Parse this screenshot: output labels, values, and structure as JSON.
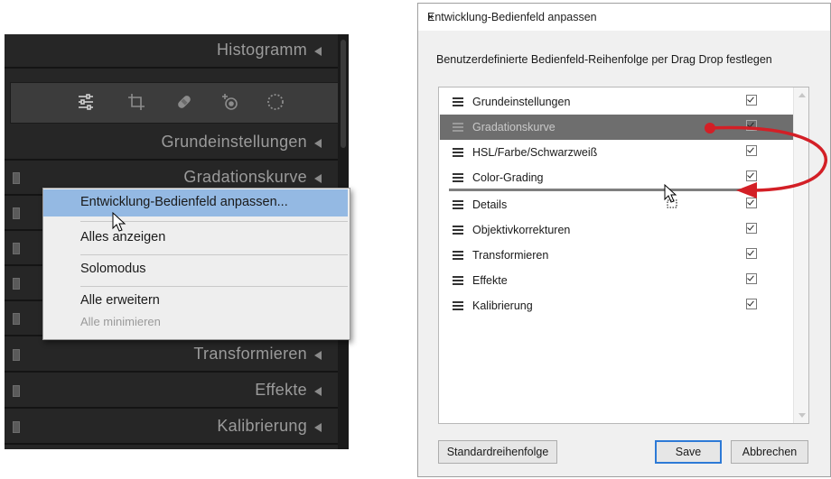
{
  "left_panel": {
    "rows": [
      {
        "label": "Histogramm"
      },
      {
        "label": "Grundeinstellungen"
      },
      {
        "label": "Gradationskurve"
      },
      {
        "label": "Transformieren"
      },
      {
        "label": "Effekte"
      },
      {
        "label": "Kalibrierung"
      }
    ],
    "tools": [
      "sliders-icon",
      "crop-icon",
      "healing-icon",
      "redeye-icon",
      "mask-icon"
    ]
  },
  "context_menu": {
    "items": [
      {
        "label": "Entwicklung-Bedienfeld anpassen..."
      },
      {
        "label": "Alles anzeigen"
      },
      {
        "label": "Solomodus"
      },
      {
        "label": "Alle erweitern"
      },
      {
        "label": "Alle minimieren"
      }
    ]
  },
  "dialog": {
    "title": "Entwicklung-Bedienfeld anpassen",
    "close": "×",
    "instruction": "Benutzerdefinierte Bedienfeld-Reihenfolge per Drag  Drop festlegen",
    "items": [
      {
        "label": "Grundeinstellungen",
        "checked": true
      },
      {
        "label": "Gradationskurve",
        "checked": true,
        "selected": true
      },
      {
        "label": "HSL/Farbe/Schwarzweiß",
        "checked": true
      },
      {
        "label": "Color-Grading",
        "checked": true
      },
      {
        "label": "Details",
        "checked": true
      },
      {
        "label": "Objektivkorrekturen",
        "checked": true
      },
      {
        "label": "Transformieren",
        "checked": true
      },
      {
        "label": "Effekte",
        "checked": true
      },
      {
        "label": "Kalibrierung",
        "checked": true
      }
    ],
    "buttons": {
      "default_order": "Standardreihenfolge",
      "save": "Save",
      "cancel": "Abbrechen"
    }
  },
  "colors": {
    "panel_bg": "#262626",
    "menu_highlight": "#94b9e3",
    "selected_row": "#6e6e6e",
    "annotation_arrow": "#d31f26"
  }
}
